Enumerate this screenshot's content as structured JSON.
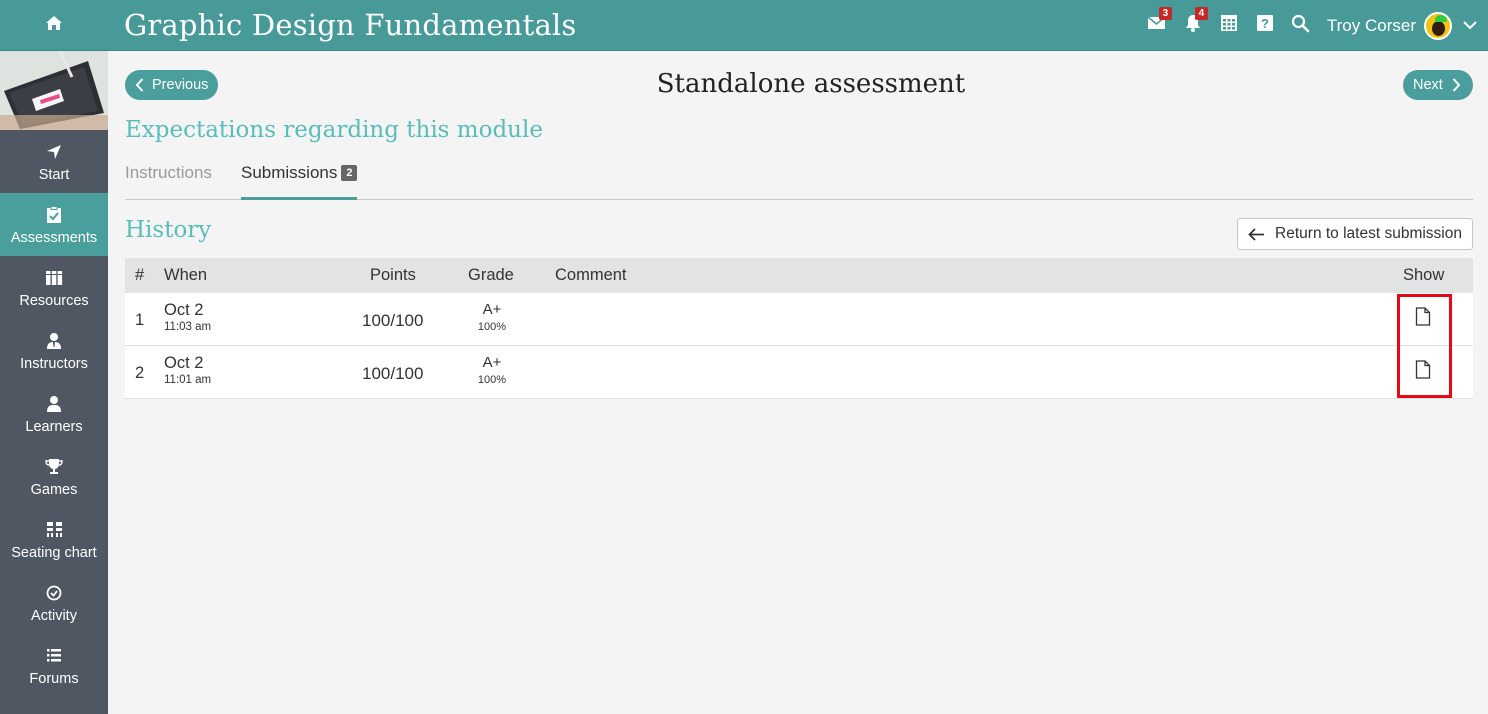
{
  "header": {
    "app_title": "Graphic Design Fundamentals",
    "mail_badge": "3",
    "notifications_badge": "4",
    "user_name": "Troy Corser",
    "icons": [
      "home-icon",
      "mail-icon",
      "bell-icon",
      "calendar-icon",
      "help-icon",
      "search-icon",
      "chevron-down-icon"
    ]
  },
  "sidebar": {
    "items": [
      {
        "label": "Start",
        "icon": "location-arrow-icon"
      },
      {
        "label": "Assessments",
        "icon": "checklist-icon",
        "active": true
      },
      {
        "label": "Resources",
        "icon": "books-icon"
      },
      {
        "label": "Instructors",
        "icon": "instructor-icon"
      },
      {
        "label": "Learners",
        "icon": "user-icon"
      },
      {
        "label": "Games",
        "icon": "trophy-icon"
      },
      {
        "label": "Seating chart",
        "icon": "seating-chart-icon"
      },
      {
        "label": "Activity",
        "icon": "clock-icon"
      },
      {
        "label": "Forums",
        "icon": "list-icon"
      }
    ]
  },
  "main": {
    "prev_label": "Previous",
    "next_label": "Next",
    "page_title": "Standalone assessment",
    "module_heading": "Expectations regarding this module",
    "tabs": {
      "instructions": "Instructions",
      "submissions": "Submissions",
      "submissions_count": "2"
    },
    "history_heading": "History",
    "return_button": "Return to latest submission",
    "table": {
      "headers": {
        "num": "#",
        "when": "When",
        "points": "Points",
        "grade": "Grade",
        "comment": "Comment",
        "show": "Show"
      },
      "rows": [
        {
          "num": "1",
          "date": "Oct 2",
          "time": "11:03 am",
          "points": "100/100",
          "grade": "A+",
          "percent": "100%",
          "comment": ""
        },
        {
          "num": "2",
          "date": "Oct 2",
          "time": "11:01 am",
          "points": "100/100",
          "grade": "A+",
          "percent": "100%",
          "comment": ""
        }
      ]
    }
  },
  "colors": {
    "topbar": "#489a98",
    "accent": "#4a9e9b",
    "heading_teal": "#59bdb9",
    "sidebar": "#4e5762",
    "highlight": "#e50914"
  }
}
